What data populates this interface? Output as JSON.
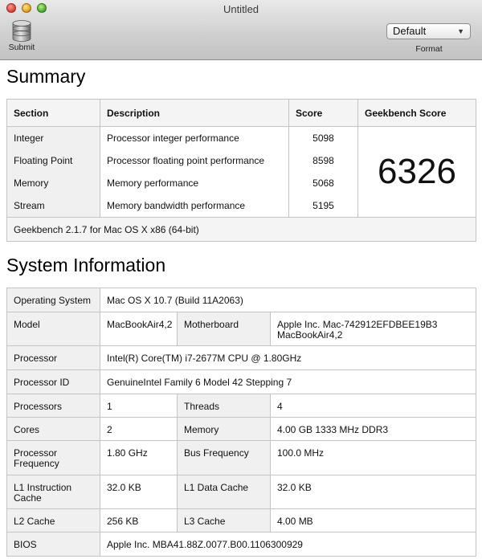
{
  "window": {
    "title": "Untitled"
  },
  "toolbar": {
    "submit_label": "Submit",
    "format_value": "Default",
    "format_label": "Format"
  },
  "summary": {
    "heading": "Summary",
    "columns": [
      "Section",
      "Description",
      "Score",
      "Geekbench Score"
    ],
    "rows": [
      {
        "section": "Integer",
        "description": "Processor integer performance",
        "score": "5098"
      },
      {
        "section": "Floating Point",
        "description": "Processor floating point performance",
        "score": "8598"
      },
      {
        "section": "Memory",
        "description": "Memory performance",
        "score": "5068"
      },
      {
        "section": "Stream",
        "description": "Memory bandwidth performance",
        "score": "5195"
      }
    ],
    "geekbench_score": "6326",
    "footer": "Geekbench 2.1.7 for Mac OS X x86 (64-bit)"
  },
  "system": {
    "heading": "System Information",
    "os_label": "Operating System",
    "os_value": "Mac OS X 10.7 (Build 11A2063)",
    "model_label": "Model",
    "model_value": "MacBookAir4,2",
    "motherboard_label": "Motherboard",
    "motherboard_value": "Apple Inc. Mac-742912EFDBEE19B3 MacBookAir4,2",
    "processor_label": "Processor",
    "processor_value": "Intel(R) Core(TM) i7-2677M CPU @ 1.80GHz",
    "processor_id_label": "Processor ID",
    "processor_id_value": "GenuineIntel Family 6 Model 42 Stepping 7",
    "processors_label": "Processors",
    "processors_value": "1",
    "threads_label": "Threads",
    "threads_value": "4",
    "cores_label": "Cores",
    "cores_value": "2",
    "memory_label": "Memory",
    "memory_value": "4.00 GB  1333 MHz DDR3",
    "proc_freq_label": "Processor Frequency",
    "proc_freq_value": "1.80 GHz",
    "bus_freq_label": "Bus Frequency",
    "bus_freq_value": "100.0 MHz",
    "l1i_label": "L1 Instruction Cache",
    "l1i_value": "32.0 KB",
    "l1d_label": "L1 Data Cache",
    "l1d_value": "32.0 KB",
    "l2_label": "L2 Cache",
    "l2_value": "256 KB",
    "l3_label": "L3 Cache",
    "l3_value": "4.00 MB",
    "bios_label": "BIOS",
    "bios_value": "Apple Inc. MBA41.88Z.0077.B00.1106300929"
  }
}
